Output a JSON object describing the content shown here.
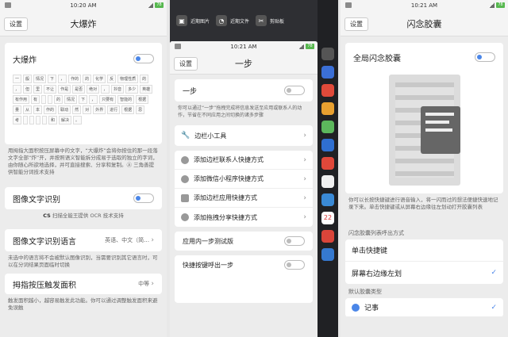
{
  "p1": {
    "time": "10:20 AM",
    "battery": "78",
    "back": "设置",
    "title": "大爆炸",
    "toggle1": "大爆炸",
    "tags": [
      "一",
      "般",
      "情况",
      "下",
      "，",
      "作的",
      "的",
      "化学",
      "反",
      "物理性质",
      "的",
      "，",
      "但",
      "里",
      "不让",
      "作是",
      "是否",
      "绝对",
      "，",
      "抖音",
      "多少",
      "英雄",
      "有作用",
      "有",
      "",
      "",
      "的",
      "情况",
      "下",
      "，",
      "只要有",
      "智能的",
      "根据",
      "量",
      "从",
      "本",
      "作的",
      "联动",
      "然",
      "对",
      "外界",
      "进行",
      "根据",
      "思",
      "考",
      "",
      "",
      "",
      "",
      "和",
      "解决",
      "。"
    ],
    "desc1": "用拇指大面积按压屏幕中的文字，“大爆炸”会将你按住的那一段落文字全部“炸”开，并按照语义智能拆分成易于选取的独立的字词，由你随心所欲地选择，并可直接搜索、分享和复制。Ⓐ 三角善提供智能分词技术支持",
    "ocr": "图像文字识别",
    "ocr_note": "扫描全能王提供 OCR 技术支持",
    "ocr_lang": "图像文字识别语言",
    "ocr_lang_val": "英语、中文（简…",
    "ocr_lang_desc": "未选中的语言将不会被默认图像识别，当需要识别其它语言时，可以在分词结果页面临时切换",
    "press": "拇指按压触发面积",
    "press_val": "中等",
    "press_desc": "触发面积越小，越容易触发此功能。你可以通过调整触发面积来避免误触"
  },
  "p2": {
    "time": "10:21 AM",
    "battery": "78",
    "tb": [
      "近期图片",
      "近期文件",
      "剪贴板"
    ],
    "back": "设置",
    "title": "一步",
    "toggle1": "一步",
    "desc1": "你可以通过“一步”拖拽完成将信息发送至应用或联系人的动作，节省在不同应用之间切换的诸多步骤",
    "sidebar_tool": "边栏小工具",
    "items": [
      "添加边栏联系人快捷方式",
      "添加微信小程序快捷方式",
      "添加边栏应用快捷方式",
      "添加拖拽分享快捷方式"
    ],
    "test": "应用内一步测试版",
    "hotkey": "快捷按键呼出一步",
    "sidebar_icons": [
      "settings-icon",
      "app-blue-icon",
      "app-red-icon",
      "app-orange-icon",
      "wechat-icon",
      "app-blue2-icon",
      "weibo-icon",
      "notes-icon",
      "app-photo-icon",
      "calendar-icon",
      "app-red2-icon",
      "app-blue3-icon"
    ],
    "cal_num": "22"
  },
  "p3": {
    "time": "10:21 AM",
    "battery": "78",
    "back": "设置",
    "title": "闪念胶囊",
    "toggle1": "全局闪念胶囊",
    "desc1": "你可以长按快捷键进行语音输入，将一闪而过的想法便捷快速地记录下来。单击快捷键或从屏幕右边缘往左划动打开胶囊列表",
    "sec1": "闪念胶囊列表呼出方式",
    "opt1": "单击快捷键",
    "opt2": "屏幕右边缘左划",
    "sec2": "默认胶囊类型",
    "opt3": "记事"
  },
  "colors": {
    "accent": "#4a86e8",
    "battery": "#57b84f"
  }
}
